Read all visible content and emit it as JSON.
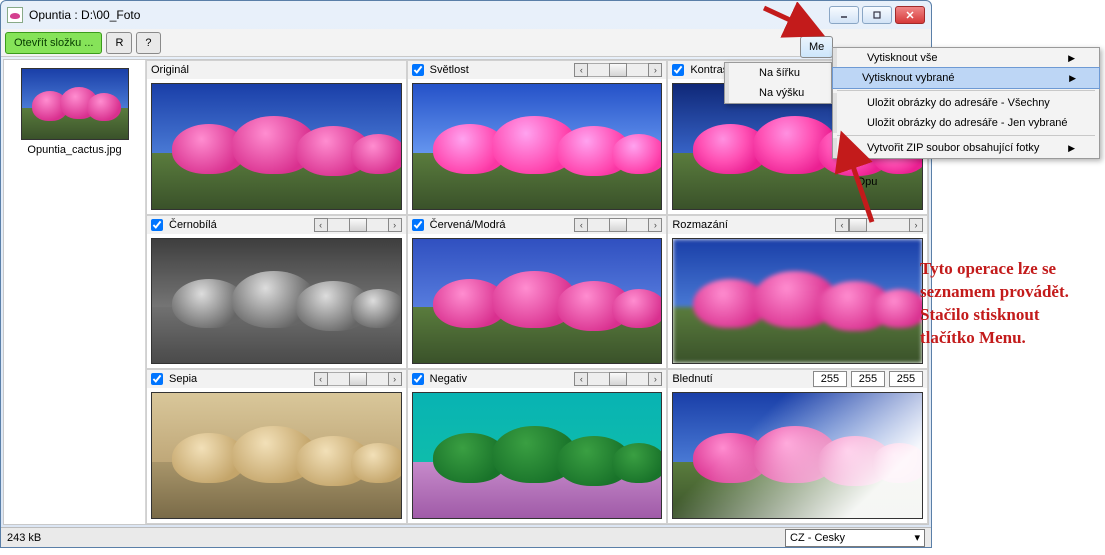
{
  "title": "Opuntia : D:\\00_Foto",
  "toolbar": {
    "open_label": "Otevřít složku ...",
    "r_label": "R",
    "q_label": "?"
  },
  "topbuttons": {
    "menu": "Me"
  },
  "thumbnail": {
    "filename": "Opuntia_cactus.jpg"
  },
  "preview_filename": "Opu",
  "cells": {
    "original": {
      "label": "Originál"
    },
    "brightness": {
      "label": "Světlost"
    },
    "contrast": {
      "label": "Kontrast"
    },
    "bw": {
      "label": "Černobílá"
    },
    "redblue": {
      "label": "Červená/Modrá"
    },
    "blur": {
      "label": "Rozmazání"
    },
    "sepia": {
      "label": "Sepia"
    },
    "negative": {
      "label": "Negativ"
    },
    "fade": {
      "label": "Blednutí",
      "v1": "255",
      "v2": "255",
      "v3": "255"
    }
  },
  "status": {
    "size": "243 kB",
    "lang": "CZ - Cesky"
  },
  "submenu": {
    "width": "Na šířku",
    "height": "Na výšku"
  },
  "mainmenu": {
    "print_all": "Vytisknout vše",
    "print_sel": "Vytisknout vybrané",
    "save_all": "Uložit obrázky do adresáře - Všechny",
    "save_sel": "Uložit obrázky do adresáře - Jen vybrané",
    "zip": "Vytvořit ZIP soubor obsahující fotky"
  },
  "annotation": {
    "l1": "Tyto operace lze se",
    "l2": "seznamem provádět.",
    "l3": "Stačilo stisknout",
    "l4": "tlačítko Menu."
  }
}
